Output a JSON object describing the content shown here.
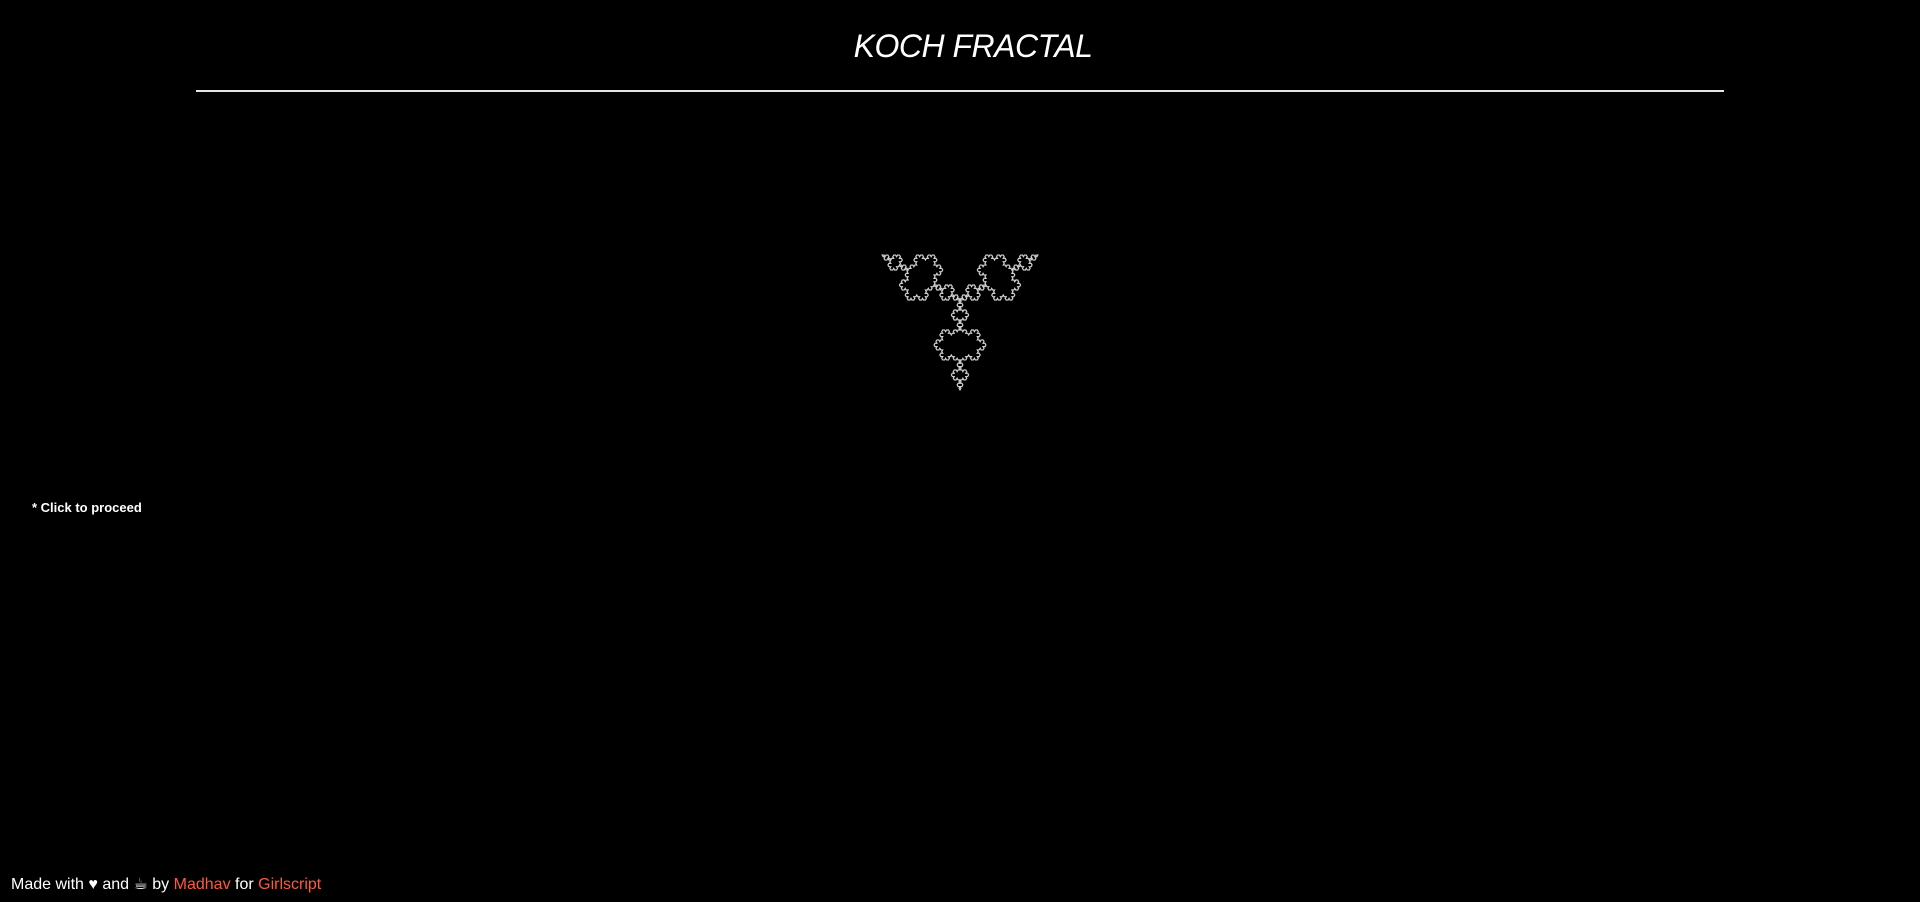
{
  "header": {
    "title": "KOCH FRACTAL"
  },
  "fractal": {
    "stroke_color": "#cfcfcf",
    "background": "#000000",
    "iterations": 4
  },
  "hint": {
    "text": "* Click to proceed"
  },
  "footer": {
    "made_with": "Made with",
    "heart": "♥",
    "and": "and",
    "coffee": "☕",
    "by": "by",
    "author": "Madhav",
    "for": "for",
    "org": "Girlscript",
    "link_color": "#ff5a3c"
  }
}
